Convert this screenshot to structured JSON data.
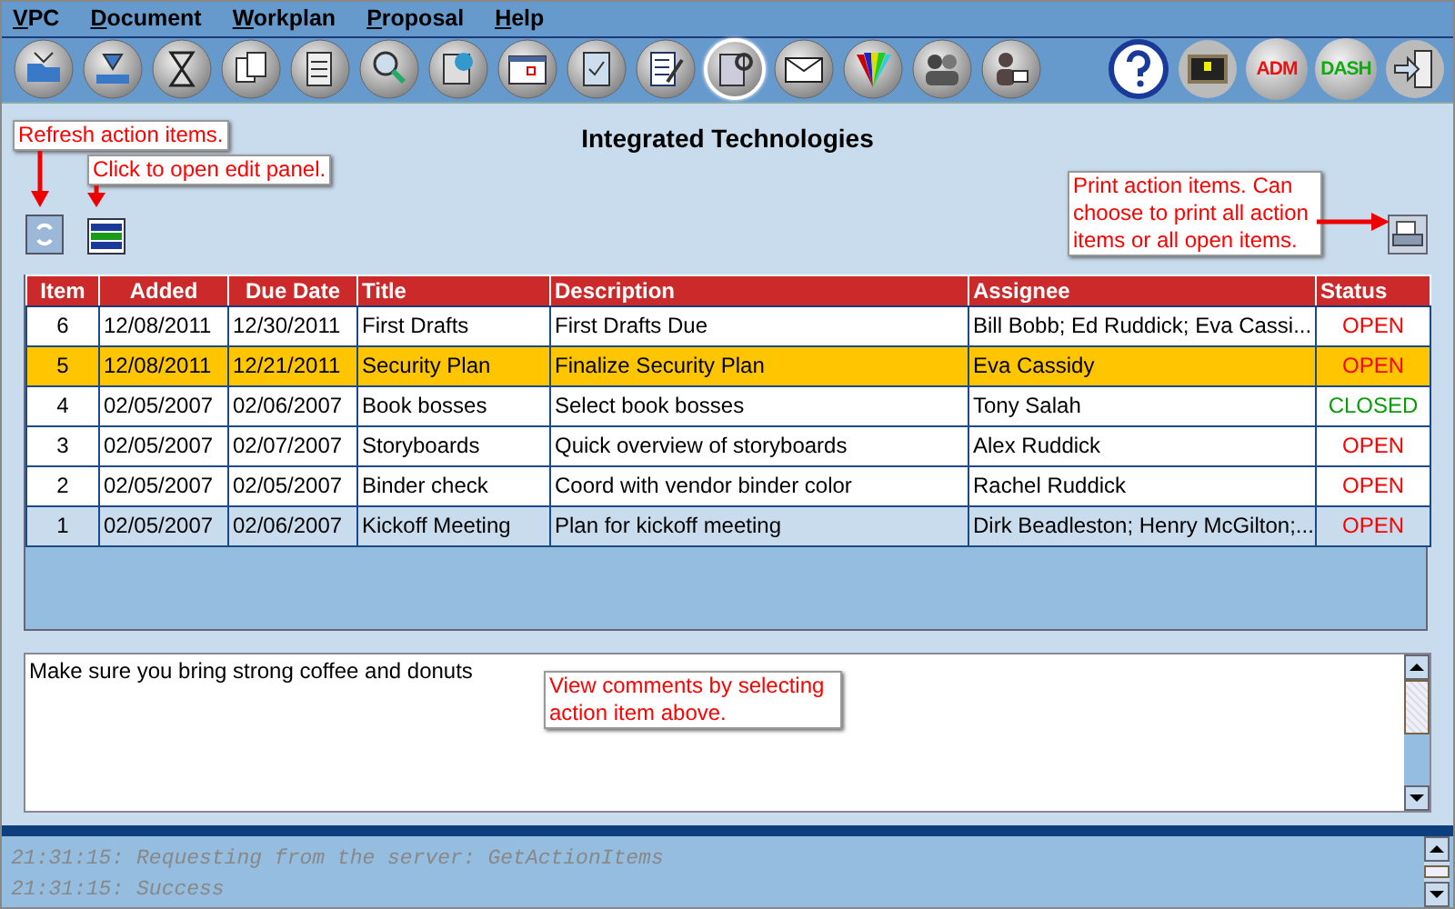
{
  "menu": [
    {
      "label": "VPC"
    },
    {
      "label": "Document"
    },
    {
      "label": "Workplan"
    },
    {
      "label": "Proposal"
    },
    {
      "label": "Help"
    }
  ],
  "toolbar_right": [
    {
      "kind": "help"
    },
    {
      "kind": "monitor"
    },
    {
      "kind": "text",
      "label": "ADM",
      "color": "#ee1111"
    },
    {
      "kind": "text",
      "label": "DASH",
      "color": "#11aa11"
    },
    {
      "kind": "exit"
    }
  ],
  "title": "Integrated Technologies",
  "callouts": [
    {
      "text": "Refresh action items."
    },
    {
      "text": "Click to open edit panel."
    },
    {
      "text": "Print action items. Can choose to print all action items or all open items."
    },
    {
      "text": "View comments by selecting action item above."
    }
  ],
  "table": {
    "columns": [
      "Item",
      "Added",
      "Due Date",
      "Title",
      "Description",
      "Assignee",
      "Status"
    ],
    "rows": [
      {
        "cells": [
          "6",
          "12/08/2011",
          "12/30/2011",
          "First Drafts",
          "First Drafts Due",
          "Bill Bobb; Ed Ruddick; Eva Cassi...",
          "OPEN"
        ],
        "selected": false,
        "focused": false,
        "color": "#ff0000"
      },
      {
        "cells": [
          "5",
          "12/08/2011",
          "12/21/2011",
          "Security Plan",
          "Finalize Security Plan",
          "Eva Cassidy",
          "OPEN"
        ],
        "selected": true,
        "focused": false,
        "color": "#ff0000"
      },
      {
        "cells": [
          "4",
          "02/05/2007",
          "02/06/2007",
          "Book bosses",
          "Select book bosses",
          "Tony Salah",
          "CLOSED"
        ],
        "selected": false,
        "focused": false,
        "color": "#0a9a0a"
      },
      {
        "cells": [
          "3",
          "02/05/2007",
          "02/07/2007",
          "Storyboards",
          "Quick overview of storyboards",
          "Alex Ruddick",
          "OPEN"
        ],
        "selected": false,
        "focused": false,
        "color": "#ff0000"
      },
      {
        "cells": [
          "2",
          "02/05/2007",
          "02/05/2007",
          "Binder check",
          "Coord with vendor binder color",
          "Rachel Ruddick",
          "OPEN"
        ],
        "selected": false,
        "focused": false,
        "color": "#ff0000"
      },
      {
        "cells": [
          "1",
          "02/05/2007",
          "02/06/2007",
          "Kickoff Meeting",
          "Plan for kickoff meeting",
          "Dirk Beadleston; Henry McGilton;...",
          "OPEN"
        ],
        "selected": false,
        "focused": true,
        "color": "#ff0000"
      }
    ]
  },
  "comments": {
    "value": "Make sure you bring strong coffee and donuts"
  },
  "log": [
    "21:31:15: Requesting from the server: GetActionItems",
    "21:31:15: Success"
  ]
}
